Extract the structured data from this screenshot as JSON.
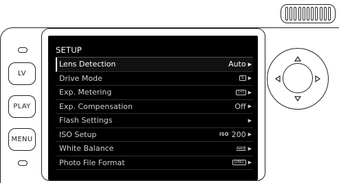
{
  "buttons": {
    "lv": "LV",
    "play": "PLAY",
    "menu": "MENU"
  },
  "screen": {
    "title": "SETUP",
    "items": [
      {
        "label": "Lens Detection",
        "value": "Auto",
        "icon": null,
        "selected": true
      },
      {
        "label": "Drive Mode",
        "value": "",
        "icon": "drive-single-icon",
        "selected": false
      },
      {
        "label": "Exp. Metering",
        "value": "",
        "icon": "metering-center-icon",
        "selected": false
      },
      {
        "label": "Exp. Compensation",
        "value": "Off",
        "icon": null,
        "selected": false
      },
      {
        "label": "Flash Settings",
        "value": "",
        "icon": null,
        "selected": false
      },
      {
        "label": "ISO Setup",
        "value": "200",
        "value_prefix": "ISO",
        "icon": null,
        "selected": false
      },
      {
        "label": "White Balance",
        "value": "",
        "icon": "awb-icon",
        "icon_text": "AWB",
        "selected": false
      },
      {
        "label": "Photo File Format",
        "value": "",
        "icon": "dng-icon",
        "icon_text": "DNG",
        "selected": false
      }
    ]
  },
  "colors": {
    "screen_bg": "#000000",
    "text": "#cfcfcf",
    "selected_text": "#ffffff",
    "outline": "#222222"
  }
}
